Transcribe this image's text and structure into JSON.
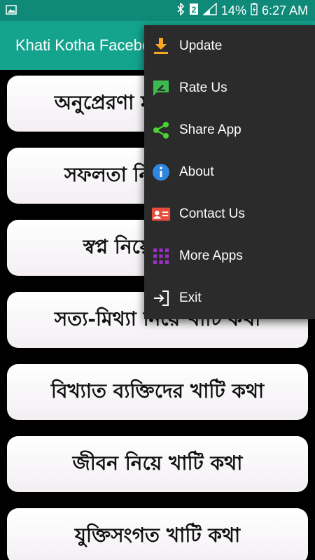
{
  "status_bar": {
    "battery_text": "14%",
    "time": "6:27 AM",
    "icons": [
      "image-notification-icon",
      "bluetooth-icon",
      "sim2-icon",
      "signal-icon",
      "battery-icon"
    ]
  },
  "app_bar": {
    "title": "Khati Kotha Facebook Status"
  },
  "list": {
    "items": [
      {
        "label": "অনুপ্রেরণা মূলক খাটি কথা"
      },
      {
        "label": "সফলতা নিয়ে খাটি কথা"
      },
      {
        "label": "স্বপ্ন নিয়ে খাটি কথা"
      },
      {
        "label": "সত্য-মিথ্যা নিয়ে খাটি কথা"
      },
      {
        "label": "বিখ্যাত ব্যক্তিদের খাটি কথা"
      },
      {
        "label": "জীবন নিয়ে খাটি কথা"
      },
      {
        "label": "যুক্তিসংগত খাটি কথা"
      }
    ]
  },
  "overflow_menu": {
    "items": [
      {
        "label": "Update",
        "icon": "download-icon",
        "color": "#f5a623"
      },
      {
        "label": "Rate Us",
        "icon": "rate-icon",
        "color": "#3dba4e"
      },
      {
        "label": "Share App",
        "icon": "share-icon",
        "color": "#4cd137"
      },
      {
        "label": "About",
        "icon": "info-icon",
        "color": "#2e86de"
      },
      {
        "label": "Contact Us",
        "icon": "contact-card-icon",
        "color": "#e74c3c"
      },
      {
        "label": "More Apps",
        "icon": "apps-grid-icon",
        "color": "#9b30c8"
      },
      {
        "label": "Exit",
        "icon": "exit-icon",
        "color": "#ffffff"
      }
    ]
  },
  "colors": {
    "status_bar": "#0f8a78",
    "app_bar": "#14a38d",
    "menu_bg": "#2b2b2b",
    "background": "#000000"
  }
}
